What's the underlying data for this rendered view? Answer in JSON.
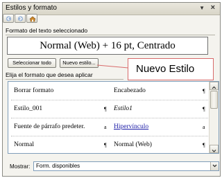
{
  "title": "Estilos y formato",
  "section_current": "Formato del texto seleccionado",
  "current_format": "Normal (Web) + 16 pt, Centrado",
  "buttons": {
    "select_all": "Seleccionar todo",
    "new_style": "Nuevo estilo..."
  },
  "callout": "Nuevo Estilo",
  "section_apply": "Elija el formato que desea aplicar",
  "styles": [
    {
      "left": "Borrar formato",
      "left_mark": "",
      "right": "Encabezado",
      "right_mark": "¶"
    },
    {
      "left": "Estilo_001",
      "left_mark": "¶",
      "right": "Estilo1",
      "right_mark": "¶"
    },
    {
      "left": "Fuente de párrafo predeter.",
      "left_mark": "a",
      "right": "Hipervínculo",
      "right_mark": "a"
    },
    {
      "left": "Normal",
      "left_mark": "¶",
      "right": "Normal (Web)",
      "right_mark": "¶"
    }
  ],
  "show": {
    "label": "Mostrar:",
    "value": "Form. disponibles"
  },
  "colors": {
    "link": "#1a1aa6",
    "callout_border": "#d86a6a",
    "list_border": "#7f9db9"
  }
}
